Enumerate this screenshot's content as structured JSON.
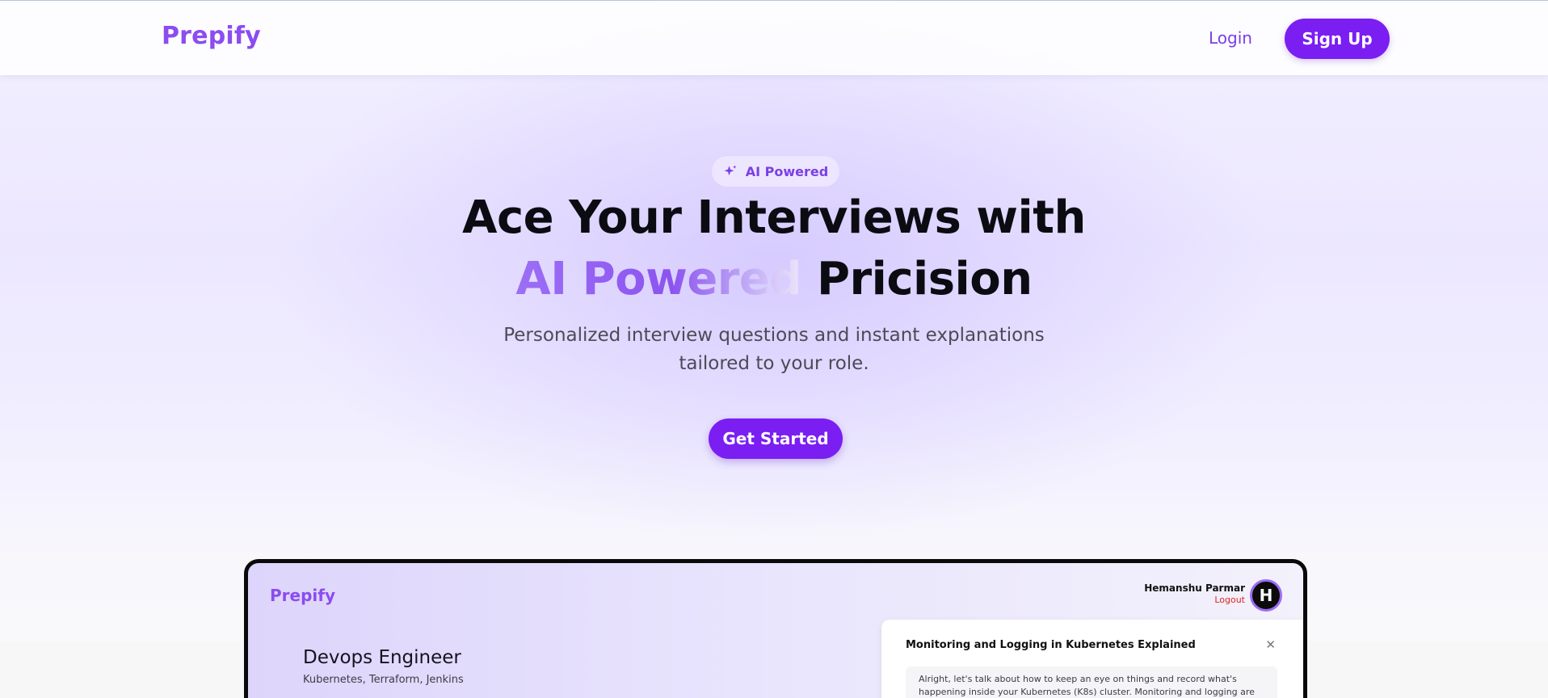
{
  "nav": {
    "logo": "Prepify",
    "login_label": "Login",
    "signup_label": "Sign Up"
  },
  "hero": {
    "badge_icon": "sparkle-icon",
    "badge_label": "AI Powered",
    "title_line1": "Ace Your Interviews with",
    "title_accent": "AI Powered",
    "title_rest": " Pricision",
    "subtitle_line1": "Personalized interview questions and instant explanations",
    "subtitle_line2": "tailored to your role.",
    "cta_label": "Get Started"
  },
  "preview": {
    "logo": "Prepify",
    "user_name": "Hemanshu Parmar",
    "logout_label": "Logout",
    "avatar_initial": "H",
    "role_title": "Devops Engineer",
    "role_tags": "Kubernetes, Terraform, Jenkins",
    "panel": {
      "title": "Monitoring and Logging in Kubernetes Explained",
      "close_icon": "close-icon",
      "body": "Alright, let's talk about how to keep an eye on things and record what's happening inside your Kubernetes (K8s) cluster. Monitoring and logging are super important"
    }
  },
  "colors": {
    "brand": "#7a1ef2",
    "logo": "#8b4cf0",
    "logout": "#e02424"
  }
}
